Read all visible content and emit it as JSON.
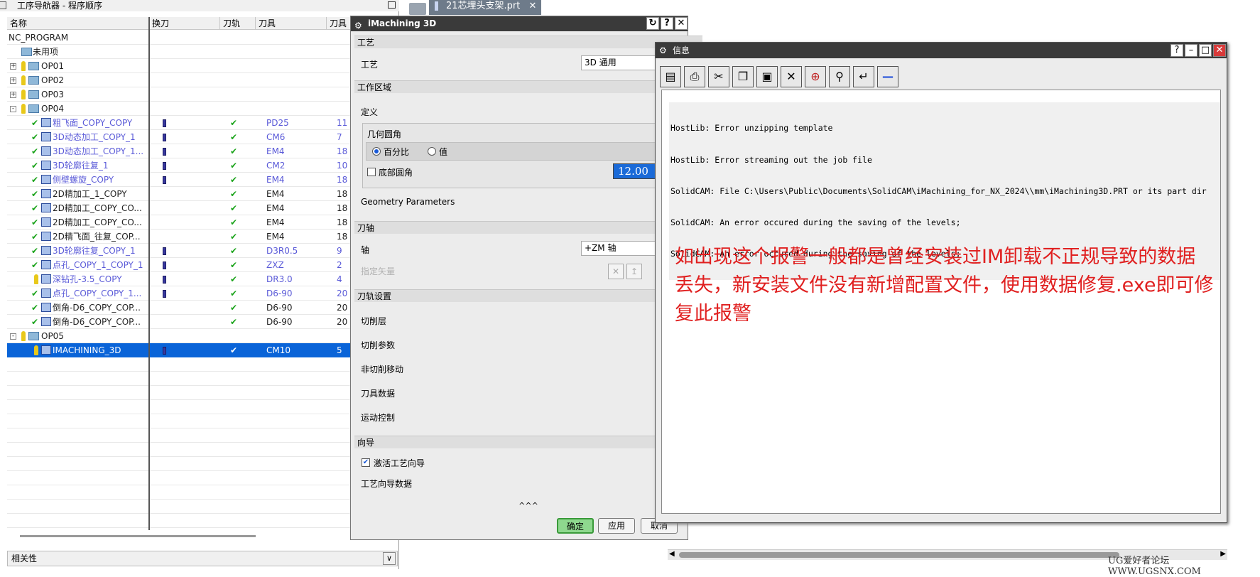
{
  "navigator": {
    "title": "工序导航器 - 程序顺序",
    "columns": [
      "名称",
      "换刀",
      "刀轨",
      "刀具",
      "刀具"
    ],
    "rows": [
      {
        "name": "NC_PROGRAM",
        "level": 0,
        "type": "root",
        "path": "",
        "tool": "",
        "num": "",
        "color": "dark",
        "tc": false
      },
      {
        "name": "未用项",
        "level": 1,
        "type": "folder",
        "path": "",
        "tool": "",
        "num": "",
        "color": "dark",
        "tc": false
      },
      {
        "name": "OP01",
        "level": 1,
        "type": "group",
        "expand": "+",
        "path": "",
        "tool": "",
        "num": "",
        "color": "dark",
        "tc": false
      },
      {
        "name": "OP02",
        "level": 1,
        "type": "group",
        "expand": "+",
        "path": "",
        "tool": "",
        "num": "",
        "color": "dark",
        "tc": false
      },
      {
        "name": "OP03",
        "level": 1,
        "type": "group",
        "expand": "+",
        "path": "",
        "tool": "",
        "num": "",
        "color": "dark",
        "tc": false
      },
      {
        "name": "OP04",
        "level": 1,
        "type": "group",
        "expand": "-",
        "path": "",
        "tool": "",
        "num": "",
        "color": "dark",
        "tc": false
      },
      {
        "name": "粗飞面_COPY_COPY",
        "level": 2,
        "type": "op",
        "path": "✔",
        "tool": "PD25",
        "num": "11",
        "color": "blue",
        "tc": true
      },
      {
        "name": "3D动态加工_COPY_1",
        "level": 2,
        "type": "op",
        "path": "✔",
        "tool": "CM6",
        "num": "7",
        "color": "blue",
        "tc": true
      },
      {
        "name": "3D动态加工_COPY_1...",
        "level": 2,
        "type": "op",
        "path": "✔",
        "tool": "EM4",
        "num": "18",
        "color": "blue",
        "tc": true
      },
      {
        "name": "3D轮廓往复_1",
        "level": 2,
        "type": "op",
        "path": "✔",
        "tool": "CM2",
        "num": "10",
        "color": "blue",
        "tc": true
      },
      {
        "name": "侧壁螺旋_COPY",
        "level": 2,
        "type": "op",
        "path": "✔",
        "tool": "EM4",
        "num": "18",
        "color": "blue",
        "tc": true
      },
      {
        "name": "2D精加工_1_COPY",
        "level": 2,
        "type": "op",
        "path": "✔",
        "tool": "EM4",
        "num": "18",
        "color": "dark",
        "tc": false
      },
      {
        "name": "2D精加工_COPY_CO...",
        "level": 2,
        "type": "op",
        "path": "✔",
        "tool": "EM4",
        "num": "18",
        "color": "dark",
        "tc": false
      },
      {
        "name": "2D精加工_COPY_CO...",
        "level": 2,
        "type": "op",
        "path": "✔",
        "tool": "EM4",
        "num": "18",
        "color": "dark",
        "tc": false
      },
      {
        "name": "2D精飞面_往复_COP...",
        "level": 2,
        "type": "op",
        "path": "✔",
        "tool": "EM4",
        "num": "18",
        "color": "dark",
        "tc": false
      },
      {
        "name": "3D轮廓往复_COPY_1",
        "level": 2,
        "type": "op",
        "path": "✔",
        "tool": "D3R0.5",
        "num": "9",
        "color": "blue",
        "tc": true
      },
      {
        "name": "点孔_COPY_1_COPY_1",
        "level": 2,
        "type": "op",
        "path": "✔",
        "tool": "ZXZ",
        "num": "2",
        "color": "blue",
        "tc": true
      },
      {
        "name": "深钻孔-3.5_COPY",
        "level": 2,
        "type": "op-nocheck",
        "path": "✔",
        "tool": "DR3.0",
        "num": "4",
        "color": "blue",
        "tc": true
      },
      {
        "name": "点孔_COPY_COPY_1...",
        "level": 2,
        "type": "op",
        "path": "✔",
        "tool": "D6-90",
        "num": "20",
        "color": "blue",
        "tc": true
      },
      {
        "name": "倒角-D6_COPY_COP...",
        "level": 2,
        "type": "op",
        "path": "✔",
        "tool": "D6-90",
        "num": "20",
        "color": "dark",
        "tc": false
      },
      {
        "name": "倒角-D6_COPY_COP...",
        "level": 2,
        "type": "op",
        "path": "✔",
        "tool": "D6-90",
        "num": "20",
        "color": "dark",
        "tc": false
      },
      {
        "name": "OP05",
        "level": 1,
        "type": "group",
        "expand": "-",
        "path": "",
        "tool": "",
        "num": "",
        "color": "dark",
        "tc": false
      },
      {
        "name": "IMACHINING_3D",
        "level": 2,
        "type": "op-nocheck",
        "path": "✔",
        "tool": "CM10",
        "num": "5",
        "color": "dark",
        "tc": true,
        "selected": true
      }
    ],
    "related": "相关性"
  },
  "file_tab": {
    "label": "21芯埋头支架.prt"
  },
  "dialog": {
    "title": "iMachining 3D",
    "sections": {
      "process": "工艺",
      "work_area": "工作区域",
      "tool_axis": "刀轴",
      "toolpath_settings": "刀轨设置",
      "guide": "向导"
    },
    "process_label": "工艺",
    "process_value": "3D 通用",
    "definition": "定义",
    "geo_fillet": "几何圆角",
    "percent": "百分比",
    "value_opt": "值",
    "bottom_fillet": "底部圆角",
    "bottom_fillet_value": "12.00",
    "geometry_params": "Geometry Parameters",
    "axis_label": "轴",
    "axis_value": "+ZM 轴",
    "specify_vector": "指定矢量",
    "items": [
      "切削层",
      "切削参数",
      "非切削移动",
      "刀具数据",
      "运动控制"
    ],
    "activate_guide": "激活工艺向导",
    "guide_data": "工艺向导数据",
    "collapse": "^^^",
    "ok": "确定",
    "apply": "应用",
    "cancel": "取消"
  },
  "info_window": {
    "title": "信息",
    "lines": [
      "HostLib: Error unzipping template",
      "HostLib: Error streaming out the job file",
      "SolidCAM: File C:\\Users\\Public\\Documents\\SolidCAM\\iMachining_for_NX_2024\\\\mm\\iMachining3D.PRT or its part dir",
      "SolidCAM: An error occured during the saving of the levels;",
      "SolidCAM: An error occured during the saving of the levels;"
    ],
    "note": "如出现这个报警一般都是曾经安装过IM卸载不正规导致的数据丢失，新安装文件没有新增配置文件，使用数据修复.exe即可修复此报警"
  },
  "watermark": "UG爱好者论坛 WWW.UGSNX.COM",
  "colors": {
    "selection": "#0a64d8",
    "check": "#1aa31a",
    "note": "#e02020",
    "link": "#5a5ad8"
  }
}
